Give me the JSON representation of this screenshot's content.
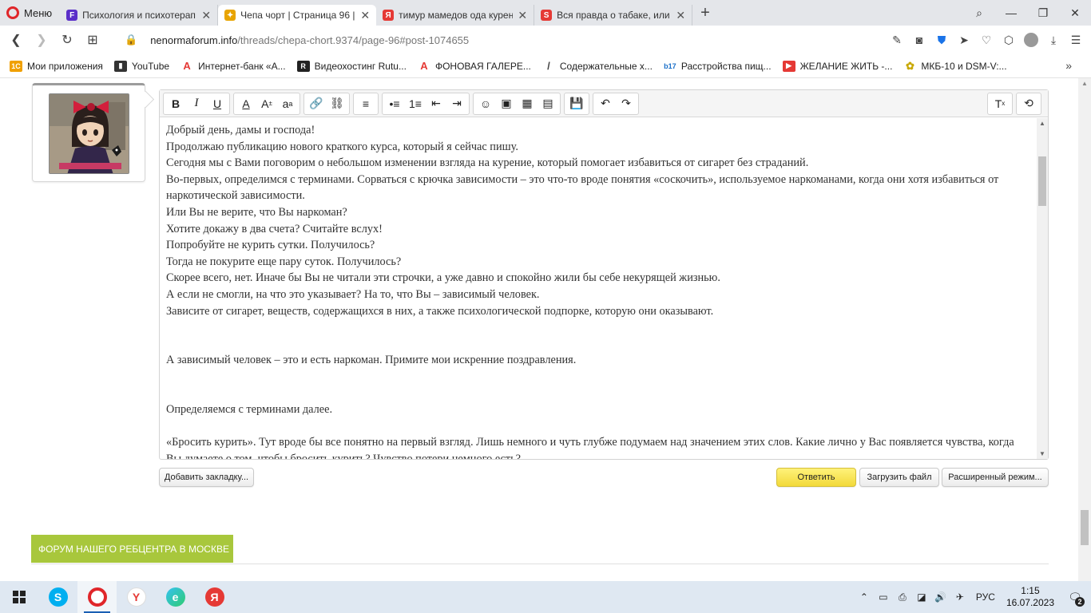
{
  "browser": {
    "menu_label": "Меню",
    "tabs": [
      {
        "title": "Психология и психотерап",
        "fav_color": "#5b2fc9",
        "fav_letter": "F"
      },
      {
        "title": "Чепа чорт | Страница 96 |",
        "fav_color": "#e8a400",
        "fav_letter": "✦"
      },
      {
        "title": "тимур мамедов ода курен",
        "fav_color": "#e53935",
        "fav_letter": "Я"
      },
      {
        "title": "Вся правда о табаке, или",
        "fav_color": "#e53935",
        "fav_letter": "S"
      }
    ],
    "url_host": "nenormaforum.info",
    "url_path": "/threads/chepa-chort.9374/page-96#post-1074655",
    "bookmarks": [
      {
        "label": "Мои приложения",
        "color": "#f0a000",
        "glyph": "1С"
      },
      {
        "label": "YouTube",
        "color": "#333333",
        "glyph": "▮"
      },
      {
        "label": "Интернет-банк «А...",
        "color": "#e53935",
        "glyph": "A"
      },
      {
        "label": "Видеохостинг Rutu...",
        "color": "#222222",
        "glyph": "R"
      },
      {
        "label": "ФОНОВАЯ ГАЛЕРЕ...",
        "color": "#e53935",
        "glyph": "A"
      },
      {
        "label": "Содержательные х...",
        "color": "#888888",
        "glyph": "/"
      },
      {
        "label": "Расстройства пищ...",
        "color": "#1a6fc9",
        "glyph": "b17"
      },
      {
        "label": "ЖЕЛАНИЕ ЖИТЬ -...",
        "color": "#e53935",
        "glyph": "▶"
      },
      {
        "label": "МКБ-10 и DSM-V:...",
        "color": "#c8a800",
        "glyph": "✿"
      }
    ]
  },
  "editor": {
    "paragraphs": [
      "Добрый день, дамы и господа!",
      "Продолжаю публикацию нового краткого курса, который я сейчас пишу.",
      "Сегодня мы с Вами поговорим о небольшом изменении взгляда на курение, который помогает избавиться от сигарет без страданий.",
      "Во-первых, определимся с терминами. Сорваться с крючка зависимости – это что-то вроде понятия «соскочить», используемое наркоманами, когда они хотя избавиться от наркотической зависимости.",
      "Или Вы не верите, что Вы наркоман?",
      "Хотите докажу в два счета? Считайте вслух!",
      "Попробуйте не курить сутки. Получилось?",
      "Тогда не покурите еще пару суток. Получилось?",
      "Скорее всего, нет. Иначе бы Вы не читали эти строчки, а уже давно и спокойно жили бы себе некурящей жизнью.",
      "А если не смогли, на что это указывает? На то, что Вы – зависимый человек.",
      "Зависите от сигарет, веществ, содержащихся в них, а также психологической подпорке, которую они оказывают.",
      "",
      "",
      "А зависимый человек – это и есть наркоман. Примите мои искренние поздравления.",
      "",
      "",
      "Определяемся с терминами далее.",
      "",
      "«Бросить курить». Тут вроде бы все понятно на первый взгляд. Лишь немного и чуть глубже подумаем над значением этих слов. Какие лично у Вас появляется чувства, когда Вы думаете о том, чтобы бросить курить? Чувство потери немного есть?"
    ]
  },
  "buttons": {
    "bookmark": "Добавить закладку...",
    "reply": "Ответить",
    "upload": "Загрузить файл",
    "advanced": "Расширенный режим..."
  },
  "forum": {
    "node_title": "ФОРУМ НАШЕГО РЕБЦЕНТРА В МОСКВЕ",
    "accent_color": "#a8c73c"
  },
  "taskbar": {
    "lang": "РУС",
    "time": "1:15",
    "date": "16.07.2023",
    "notif_count": "2"
  }
}
